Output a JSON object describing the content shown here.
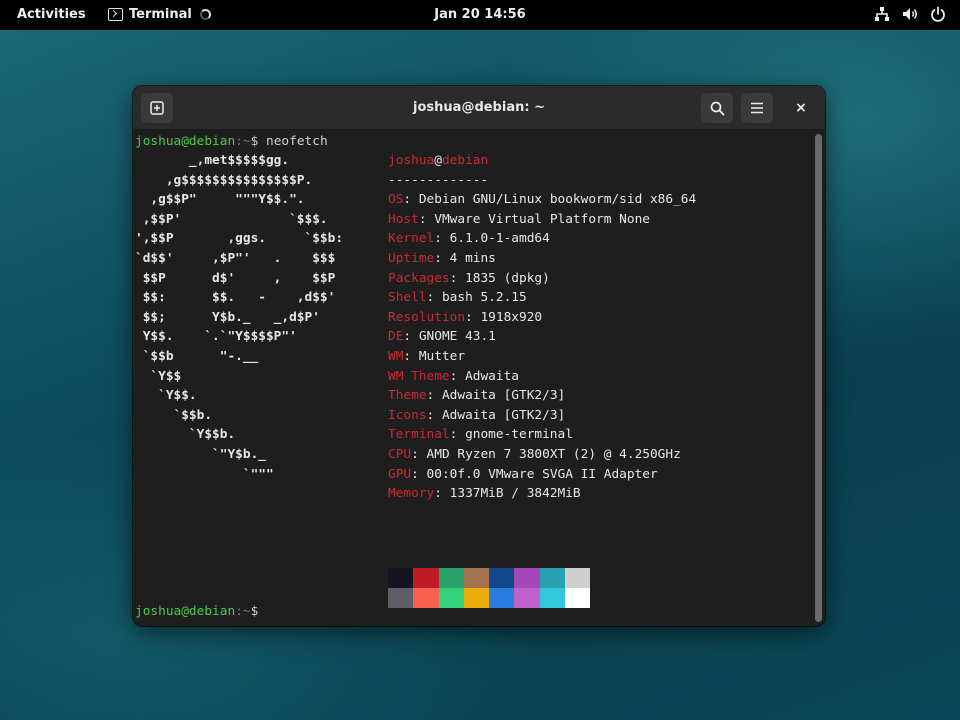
{
  "topbar": {
    "activities": "Activities",
    "app_name": "Terminal",
    "clock": "Jan 20  14:56",
    "icons": [
      "network-icon",
      "volume-icon",
      "power-icon"
    ]
  },
  "window": {
    "title": "joshua@debian: ~",
    "buttons": [
      "new-tab-icon",
      "search-icon",
      "menu-icon",
      "close-icon"
    ],
    "close_glyph": "×"
  },
  "terminal": {
    "prompt_user": "joshua@debian",
    "prompt_sep": ":~",
    "prompt_symbol": "$",
    "command": " neofetch",
    "logo_lines": [
      "       _,met$$$$$gg.",
      "    ,g$$$$$$$$$$$$$$$P.",
      "  ,g$$P\"     \"\"\"Y$$.\".",
      " ,$$P'              `$$$.",
      "',$$P       ,ggs.     `$$b:",
      "`d$$'     ,$P\"'   .    $$$",
      " $$P      d$'     ,    $$P",
      " $$:      $$.   -    ,d$$'",
      " $$;      Y$b._   _,d$P'",
      " Y$$.    `.`\"Y$$$$P\"'",
      " `$$b      \"-.__",
      "  `Y$$",
      "   `Y$$.",
      "     `$$b.",
      "       `Y$$b.",
      "          `\"Y$b._",
      "              `\"\"\""
    ],
    "info": {
      "user": "joshua",
      "at": "@",
      "host": "debian",
      "separator": "-------------",
      "rows": [
        {
          "key": "OS",
          "value": "Debian GNU/Linux bookworm/sid x86_64"
        },
        {
          "key": "Host",
          "value": "VMware Virtual Platform None"
        },
        {
          "key": "Kernel",
          "value": "6.1.0-1-amd64"
        },
        {
          "key": "Uptime",
          "value": "4 mins"
        },
        {
          "key": "Packages",
          "value": "1835 (dpkg)"
        },
        {
          "key": "Shell",
          "value": "bash 5.2.15"
        },
        {
          "key": "Resolution",
          "value": "1918x920"
        },
        {
          "key": "DE",
          "value": "GNOME 43.1"
        },
        {
          "key": "WM",
          "value": "Mutter"
        },
        {
          "key": "WM Theme",
          "value": "Adwaita"
        },
        {
          "key": "Theme",
          "value": "Adwaita [GTK2/3]"
        },
        {
          "key": "Icons",
          "value": "Adwaita [GTK2/3]"
        },
        {
          "key": "Terminal",
          "value": "gnome-terminal"
        },
        {
          "key": "CPU",
          "value": "AMD Ryzen 7 3800XT (2) @ 4.250GHz"
        },
        {
          "key": "GPU",
          "value": "00:0f.0 VMware SVGA II Adapter"
        },
        {
          "key": "Memory",
          "value": "1337MiB / 3842MiB"
        }
      ]
    },
    "palette": [
      "#171421",
      "#c01c28",
      "#26a269",
      "#a2734c",
      "#12488b",
      "#a347ba",
      "#2aa1b3",
      "#d0cfcc",
      "#5e5c64",
      "#f66151",
      "#33d17a",
      "#e9ad0c",
      "#2a7bde",
      "#c061cb",
      "#33c7de",
      "#ffffff"
    ]
  }
}
